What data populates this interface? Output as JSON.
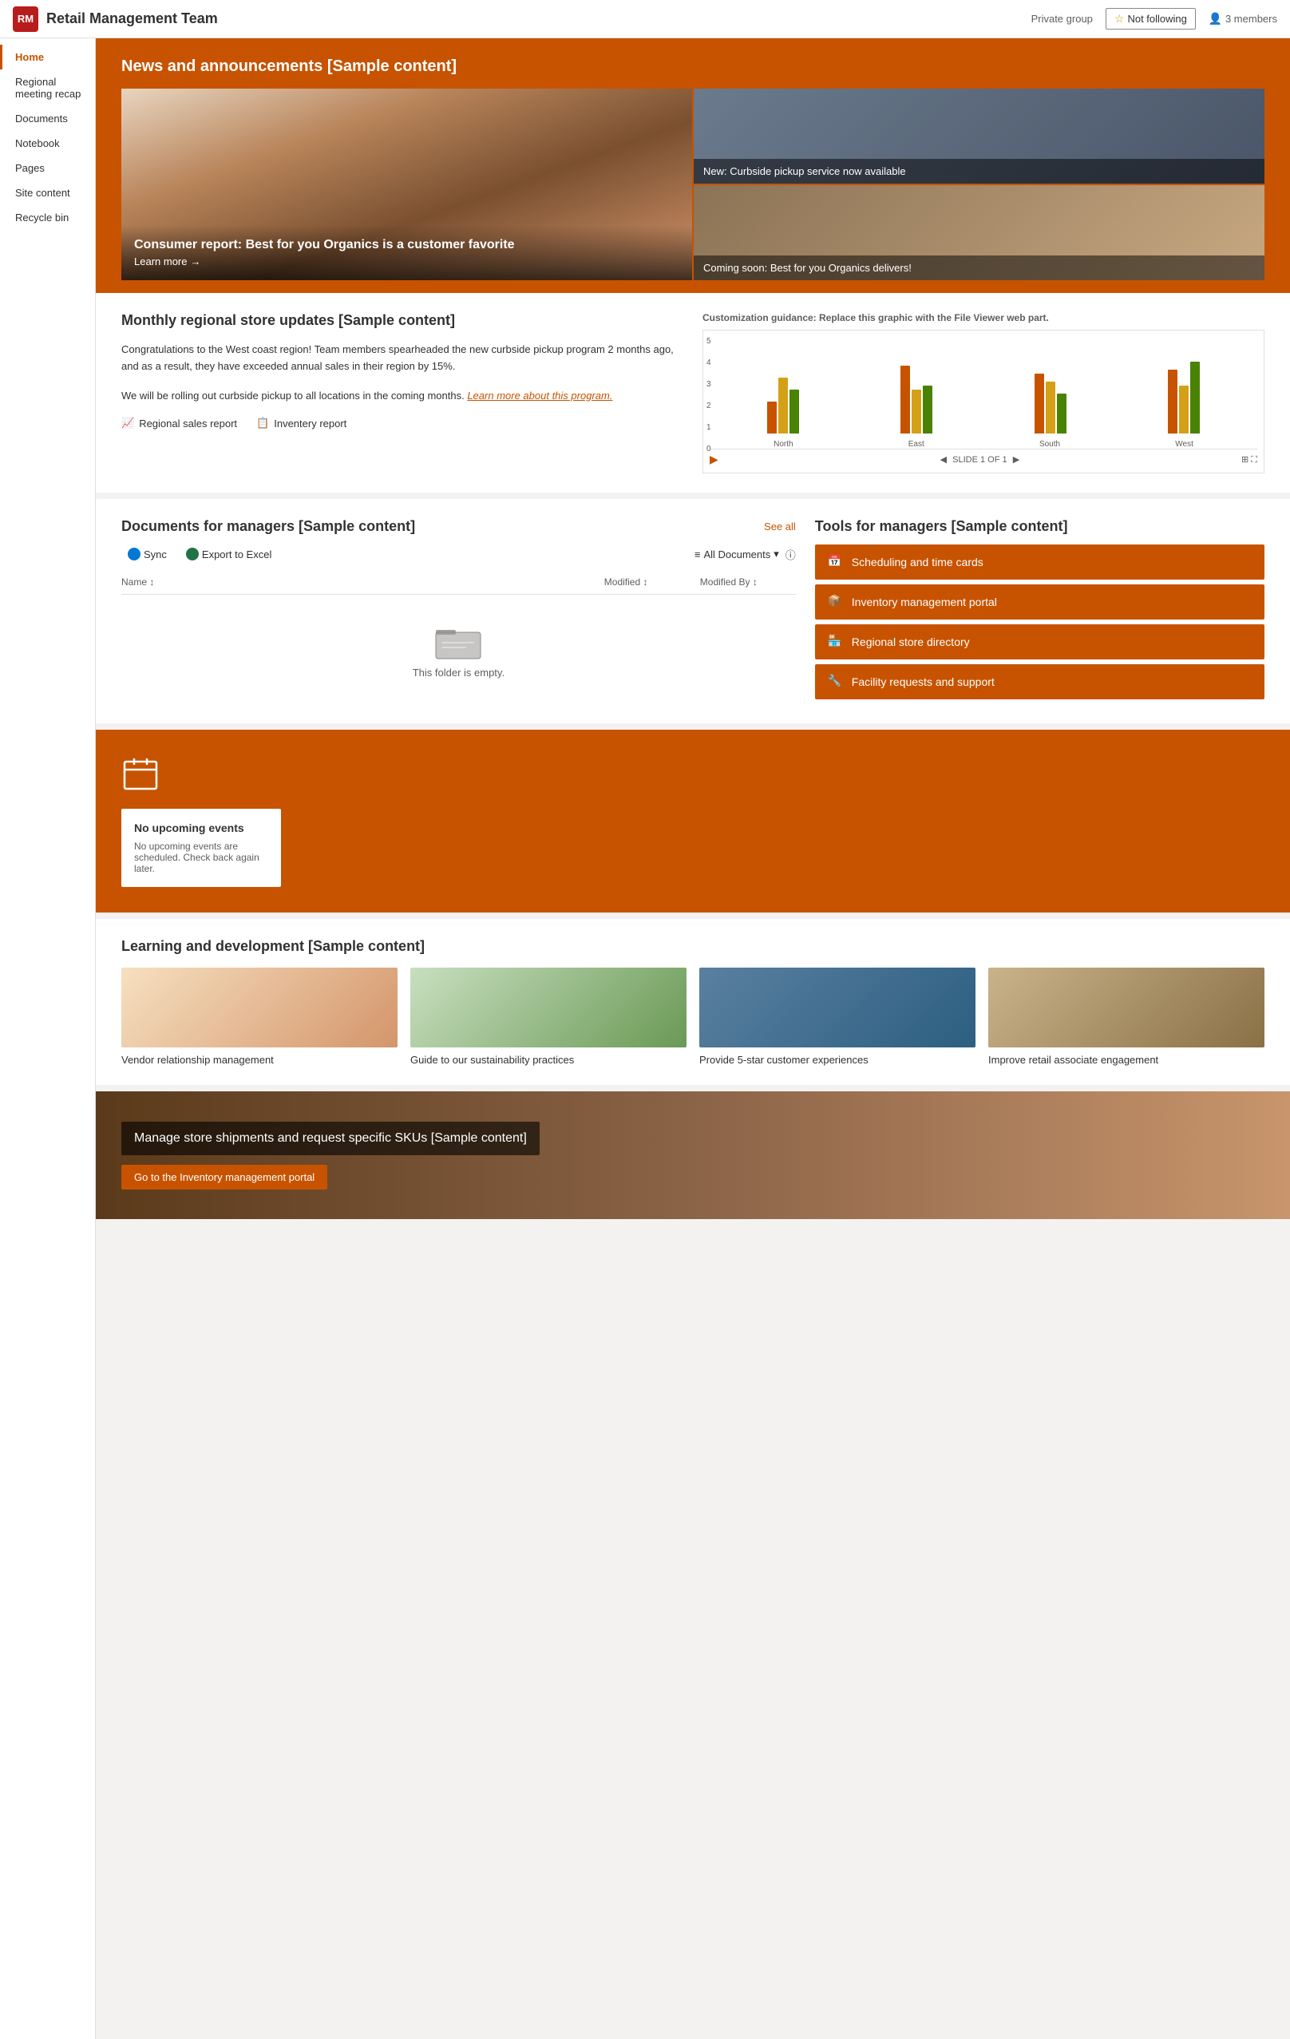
{
  "header": {
    "logo_text": "RM",
    "site_title": "Retail Management Team",
    "group_type": "Private group",
    "not_following": "Not following",
    "members": "3 members"
  },
  "sidebar": {
    "items": [
      {
        "label": "Home",
        "active": true
      },
      {
        "label": "Regional meeting recap",
        "active": false
      },
      {
        "label": "Documents",
        "active": false
      },
      {
        "label": "Notebook",
        "active": false
      },
      {
        "label": "Pages",
        "active": false
      },
      {
        "label": "Site content",
        "active": false
      },
      {
        "label": "Recycle bin",
        "active": false
      }
    ]
  },
  "hero": {
    "title": "News and announcements [Sample content]",
    "news_main_title": "Consumer report: Best for you Organics is a customer favorite",
    "learn_more": "Learn more",
    "news_item1": "New: Curbside pickup service now available",
    "news_item2": "Coming soon: Best for you Organics delivers!"
  },
  "monthly_updates": {
    "title": "Monthly regional store updates [Sample content]",
    "body1": "Congratulations to the West coast region! Team members spearheaded the new curbside pickup program 2 months ago, and as a result, they have exceeded annual sales in their region by 15%.",
    "body2": "We will be rolling out curbside pickup to all locations in the coming months.",
    "learn_link": "Learn more about this program.",
    "chart": {
      "customization_label": "Customization guidance:",
      "customization_text": " Replace this graphic with the File Viewer web part.",
      "groups": [
        "North",
        "East",
        "South",
        "West"
      ],
      "bars": [
        {
          "orange": 40,
          "yellow": 70,
          "green": 55
        },
        {
          "orange": 85,
          "yellow": 55,
          "green": 60
        },
        {
          "orange": 75,
          "yellow": 65,
          "green": 50
        },
        {
          "orange": 80,
          "yellow": 60,
          "green": 90
        }
      ],
      "y_labels": [
        "5",
        "4",
        "3",
        "2",
        "1",
        "0"
      ],
      "slide_info": "SLIDE 1 OF 1"
    },
    "report1": "Regional sales report",
    "report2": "Inventery report"
  },
  "documents": {
    "title": "Documents for managers [Sample content]",
    "see_all": "See all",
    "sync_label": "Sync",
    "export_label": "Export to Excel",
    "all_documents": "All Documents",
    "col_name": "Name",
    "col_modified": "Modified",
    "col_modified_by": "Modified By",
    "empty_label": "This folder is empty."
  },
  "tools": {
    "title": "Tools for managers [Sample content]",
    "items": [
      {
        "label": "Scheduling and time cards",
        "icon": "calendar-icon"
      },
      {
        "label": "Inventory management portal",
        "icon": "grid-icon"
      },
      {
        "label": "Regional store directory",
        "icon": "building-icon"
      },
      {
        "label": "Facility requests and support",
        "icon": "wrench-icon"
      }
    ]
  },
  "events": {
    "no_events_title": "No upcoming events",
    "no_events_body": "No upcoming events are scheduled. Check back again later."
  },
  "learning": {
    "title": "Learning and development [Sample content]",
    "cards": [
      {
        "title": "Vendor relationship management",
        "img_class": "img-vendor"
      },
      {
        "title": "Guide to our sustainability practices",
        "img_class": "img-sustain"
      },
      {
        "title": "Provide 5-star customer experiences",
        "img_class": "img-customer"
      },
      {
        "title": "Improve retail associate engagement",
        "img_class": "img-retail"
      }
    ]
  },
  "cta": {
    "text": "Manage store shipments and request specific SKUs [Sample content]",
    "button_label": "Go to the Inventory management portal"
  }
}
